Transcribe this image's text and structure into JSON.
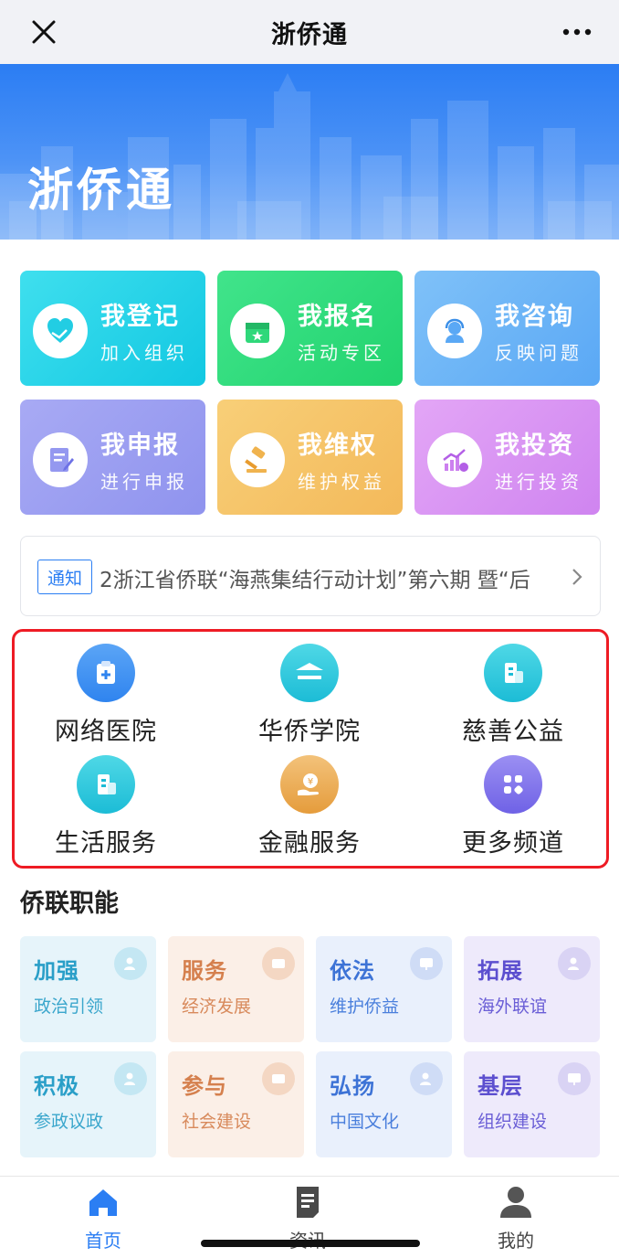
{
  "nav": {
    "title": "浙侨通",
    "close_icon": "close-icon",
    "more_icon": "more-dots-icon"
  },
  "banner": {
    "brand": "浙侨通"
  },
  "quick_tiles": [
    {
      "title": "我登记",
      "subtitle": "加入组织",
      "icon": "heart-hands-icon",
      "color": "#1ed3e6"
    },
    {
      "title": "我报名",
      "subtitle": "活动专区",
      "icon": "calendar-star-icon",
      "color": "#2fdc7c"
    },
    {
      "title": "我咨询",
      "subtitle": "反映问题",
      "icon": "headset-icon",
      "color": "#6ab4f7"
    },
    {
      "title": "我申报",
      "subtitle": "进行申报",
      "icon": "edit-form-icon",
      "color": "#9c9ff3"
    },
    {
      "title": "我维权",
      "subtitle": "维护权益",
      "icon": "gavel-icon",
      "color": "#f6c56a"
    },
    {
      "title": "我投资",
      "subtitle": "进行投资",
      "icon": "invest-chart-icon",
      "color": "#d58ef2"
    }
  ],
  "notice": {
    "tag": "通知",
    "text": "2浙江省侨联“海燕集结行动计划”第六期 暨“后",
    "arrow_icon": "chevron-right-icon"
  },
  "services": [
    {
      "label": "网络医院",
      "icon": "medical-clipboard-icon"
    },
    {
      "label": "华侨学院",
      "icon": "school-roof-icon"
    },
    {
      "label": "慈善公益",
      "icon": "building-icon"
    },
    {
      "label": "生活服务",
      "icon": "building-icon"
    },
    {
      "label": "金融服务",
      "icon": "money-hand-icon"
    },
    {
      "label": "更多频道",
      "icon": "grid-apps-icon"
    }
  ],
  "section": {
    "title": "侨联职能"
  },
  "functions": [
    {
      "title": "加强",
      "subtitle": "政治引领",
      "theme": "teal"
    },
    {
      "title": "服务",
      "subtitle": "经济发展",
      "theme": "orange"
    },
    {
      "title": "依法",
      "subtitle": "维护侨益",
      "theme": "blue"
    },
    {
      "title": "拓展",
      "subtitle": "海外联谊",
      "theme": "purple"
    },
    {
      "title": "积极",
      "subtitle": "参政议政",
      "theme": "teal"
    },
    {
      "title": "参与",
      "subtitle": "社会建设",
      "theme": "orange"
    },
    {
      "title": "弘扬",
      "subtitle": "中国文化",
      "theme": "blue"
    },
    {
      "title": "基层",
      "subtitle": "组织建设",
      "theme": "purple"
    }
  ],
  "tabbar": [
    {
      "label": "首页",
      "icon": "home-icon",
      "active": true
    },
    {
      "label": "资讯",
      "icon": "document-icon",
      "active": false
    },
    {
      "label": "我的",
      "icon": "user-icon",
      "active": false
    }
  ],
  "colors": {
    "accent": "#2b7ef3",
    "highlight_border": "#ee1b24"
  }
}
